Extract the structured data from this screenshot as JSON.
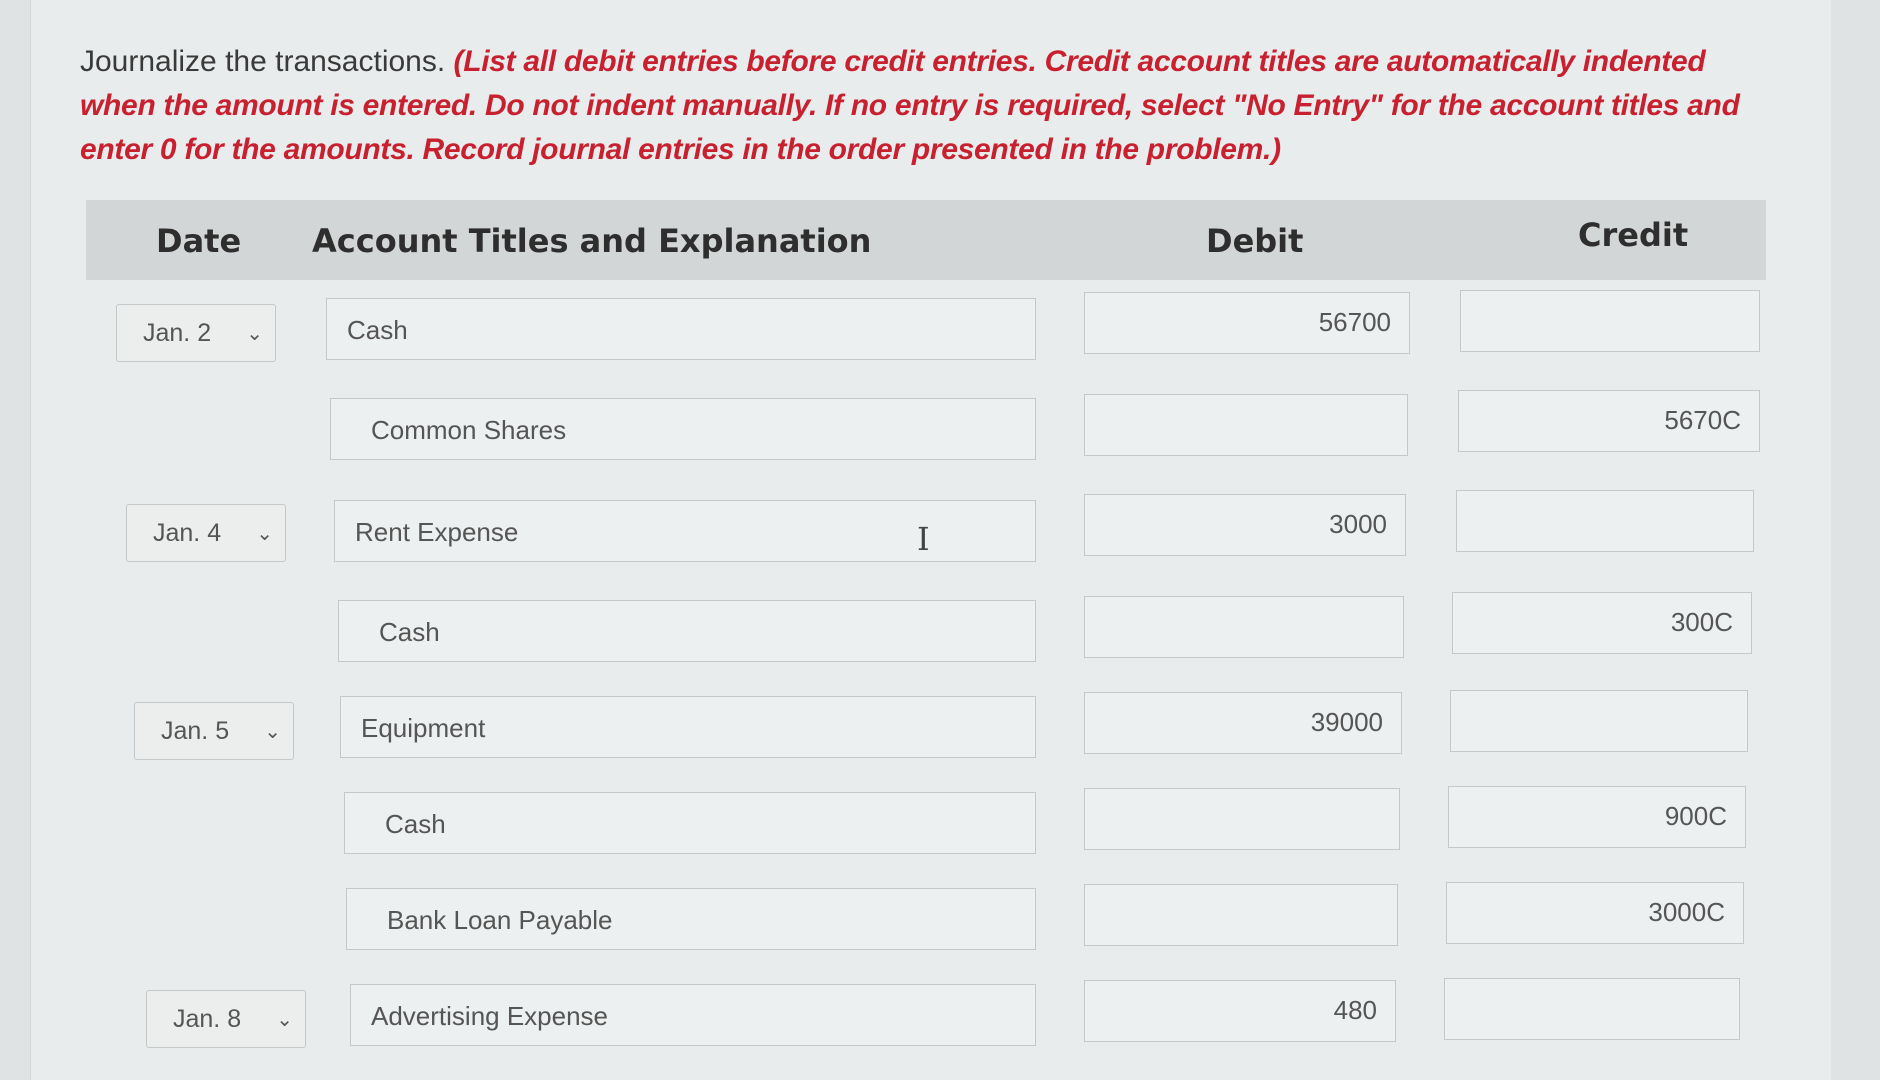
{
  "instructions": {
    "lead": "Journalize the transactions.",
    "detail": "(List all debit entries before credit entries. Credit account titles are automatically indented when the amount is entered. Do not indent manually. If no entry is required, select \"No Entry\" for the account titles and enter 0 for the amounts. Record journal entries in the order presented in the problem.)"
  },
  "table": {
    "headers": {
      "date": "Date",
      "account": "Account Titles and Explanation",
      "debit": "Debit",
      "credit": "Credit"
    },
    "rows": [
      {
        "date": "Jan. 2",
        "account": "Cash",
        "debit": "56700",
        "credit": ""
      },
      {
        "date": "",
        "account": "Common Shares",
        "debit": "",
        "credit": "5670C"
      },
      {
        "date": "Jan. 4",
        "account": "Rent Expense",
        "debit": "3000",
        "credit": ""
      },
      {
        "date": "",
        "account": "Cash",
        "debit": "",
        "credit": "300C"
      },
      {
        "date": "Jan. 5",
        "account": "Equipment",
        "debit": "39000",
        "credit": ""
      },
      {
        "date": "",
        "account": "Cash",
        "debit": "",
        "credit": "900C"
      },
      {
        "date": "",
        "account": "Bank Loan Payable",
        "debit": "",
        "credit": "3000C"
      },
      {
        "date": "Jan. 8",
        "account": "Advertising Expense",
        "debit": "480",
        "credit": ""
      }
    ]
  },
  "icons": {
    "date_dropdown": "chevron-down-icon",
    "text_cursor": "text-cursor-icon"
  }
}
